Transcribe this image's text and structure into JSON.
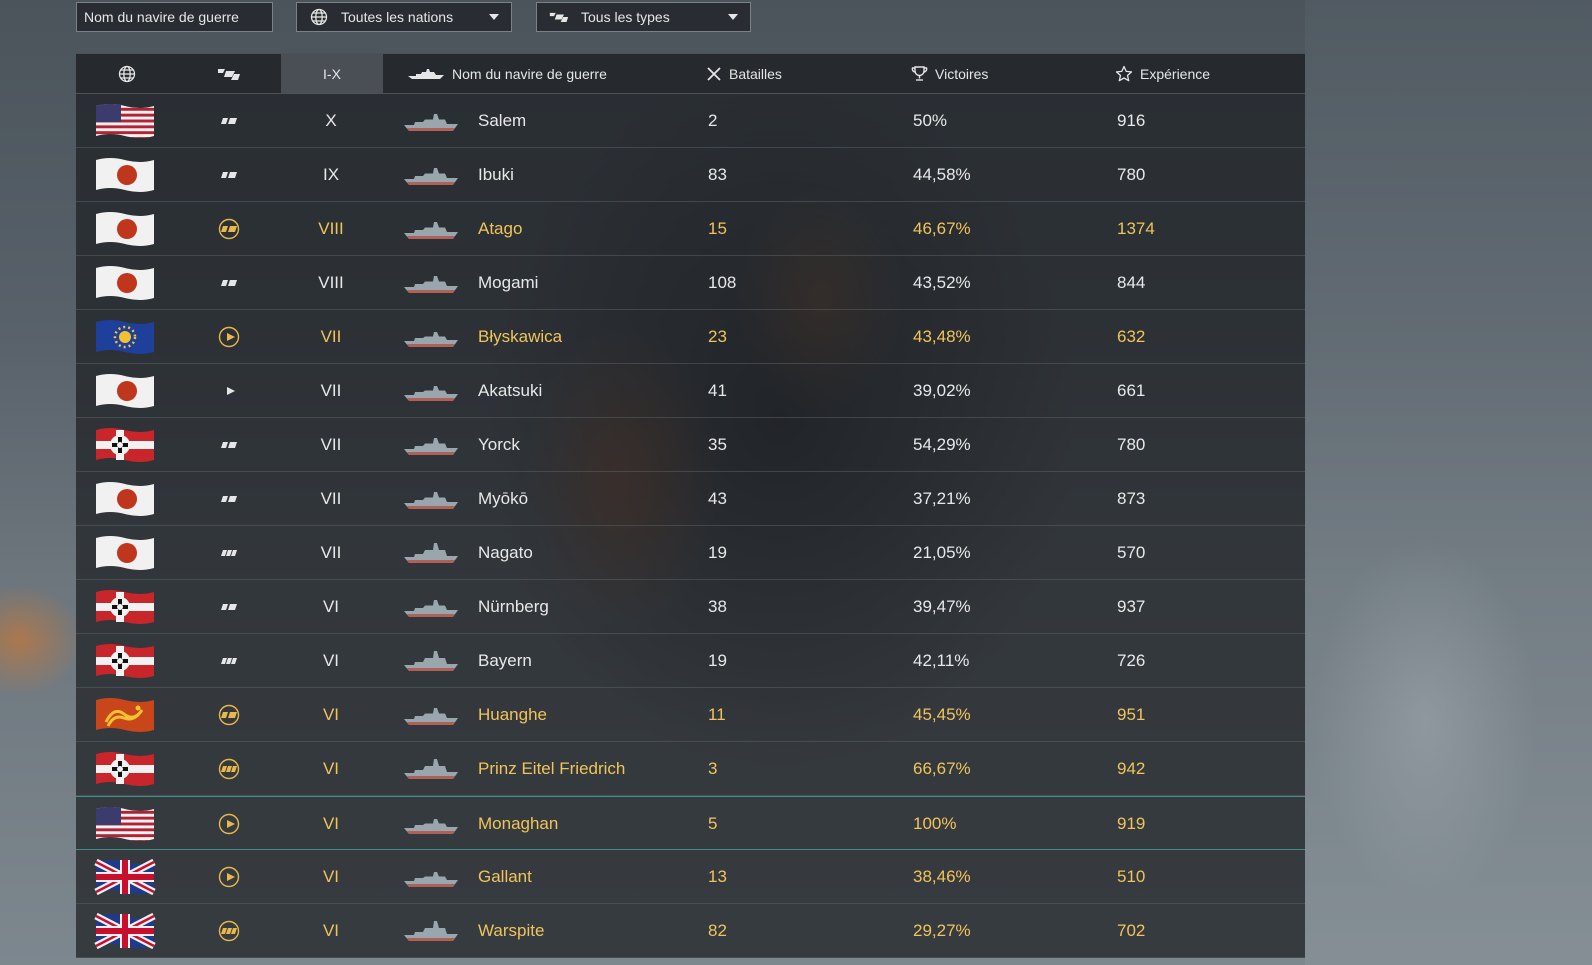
{
  "filters": {
    "search_placeholder": "Nom du navire de guerre",
    "nation_select": {
      "icon": "globe-icon",
      "selected": "Toutes les nations"
    },
    "type_select": {
      "icon": "ship-type-icon",
      "selected": "Tous les types"
    }
  },
  "headers": {
    "nation_icon": "globe-icon",
    "type_icon": "ship-type-icon",
    "tier": "I-X",
    "ship_icon": "ship-silhouette-icon",
    "name": "Nom du navire de guerre",
    "battles_icon": "crossed-swords-icon",
    "battles": "Batailles",
    "wins_icon": "trophy-icon",
    "wins": "Victoires",
    "xp_icon": "star-icon",
    "xp": "Expérience"
  },
  "colors": {
    "premium_text": "#f0c45a",
    "normal_text": "#e8e8e8",
    "highlight_border": "#3f8f87"
  },
  "rows": [
    {
      "nation": "usa",
      "type": "cruiser",
      "premium": false,
      "tier": "X",
      "name": "Salem",
      "battles": "2",
      "wins": "50%",
      "xp": "916"
    },
    {
      "nation": "japan",
      "type": "cruiser",
      "premium": false,
      "tier": "IX",
      "name": "Ibuki",
      "battles": "83",
      "wins": "44,58%",
      "xp": "780"
    },
    {
      "nation": "japan",
      "type": "cruiser",
      "premium": true,
      "tier": "VIII",
      "name": "Atago",
      "battles": "15",
      "wins": "46,67%",
      "xp": "1374"
    },
    {
      "nation": "japan",
      "type": "cruiser",
      "premium": false,
      "tier": "VIII",
      "name": "Mogami",
      "battles": "108",
      "wins": "43,52%",
      "xp": "844"
    },
    {
      "nation": "pan-europe",
      "type": "destroyer",
      "premium": true,
      "tier": "VII",
      "name": "Błyskawica",
      "battles": "23",
      "wins": "43,48%",
      "xp": "632"
    },
    {
      "nation": "japan",
      "type": "destroyer",
      "premium": false,
      "tier": "VII",
      "name": "Akatsuki",
      "battles": "41",
      "wins": "39,02%",
      "xp": "661"
    },
    {
      "nation": "germany",
      "type": "cruiser",
      "premium": false,
      "tier": "VII",
      "name": "Yorck",
      "battles": "35",
      "wins": "54,29%",
      "xp": "780"
    },
    {
      "nation": "japan",
      "type": "cruiser",
      "premium": false,
      "tier": "VII",
      "name": "Myōkō",
      "battles": "43",
      "wins": "37,21%",
      "xp": "873"
    },
    {
      "nation": "japan",
      "type": "battleship",
      "premium": false,
      "tier": "VII",
      "name": "Nagato",
      "battles": "19",
      "wins": "21,05%",
      "xp": "570"
    },
    {
      "nation": "germany",
      "type": "cruiser",
      "premium": false,
      "tier": "VI",
      "name": "Nürnberg",
      "battles": "38",
      "wins": "39,47%",
      "xp": "937"
    },
    {
      "nation": "germany",
      "type": "battleship",
      "premium": false,
      "tier": "VI",
      "name": "Bayern",
      "battles": "19",
      "wins": "42,11%",
      "xp": "726"
    },
    {
      "nation": "pan-asia",
      "type": "cruiser",
      "premium": true,
      "tier": "VI",
      "name": "Huanghe",
      "battles": "11",
      "wins": "45,45%",
      "xp": "951"
    },
    {
      "nation": "germany",
      "type": "battleship",
      "premium": true,
      "tier": "VI",
      "name": "Prinz Eitel Friedrich",
      "battles": "3",
      "wins": "66,67%",
      "xp": "942"
    },
    {
      "nation": "usa",
      "type": "destroyer",
      "premium": true,
      "tier": "VI",
      "name": "Monaghan",
      "battles": "5",
      "wins": "100%",
      "xp": "919",
      "highlight": true
    },
    {
      "nation": "uk",
      "type": "destroyer",
      "premium": true,
      "tier": "VI",
      "name": "Gallant",
      "battles": "13",
      "wins": "38,46%",
      "xp": "510"
    },
    {
      "nation": "uk",
      "type": "battleship",
      "premium": true,
      "tier": "VI",
      "name": "Warspite",
      "battles": "82",
      "wins": "29,27%",
      "xp": "702"
    }
  ]
}
